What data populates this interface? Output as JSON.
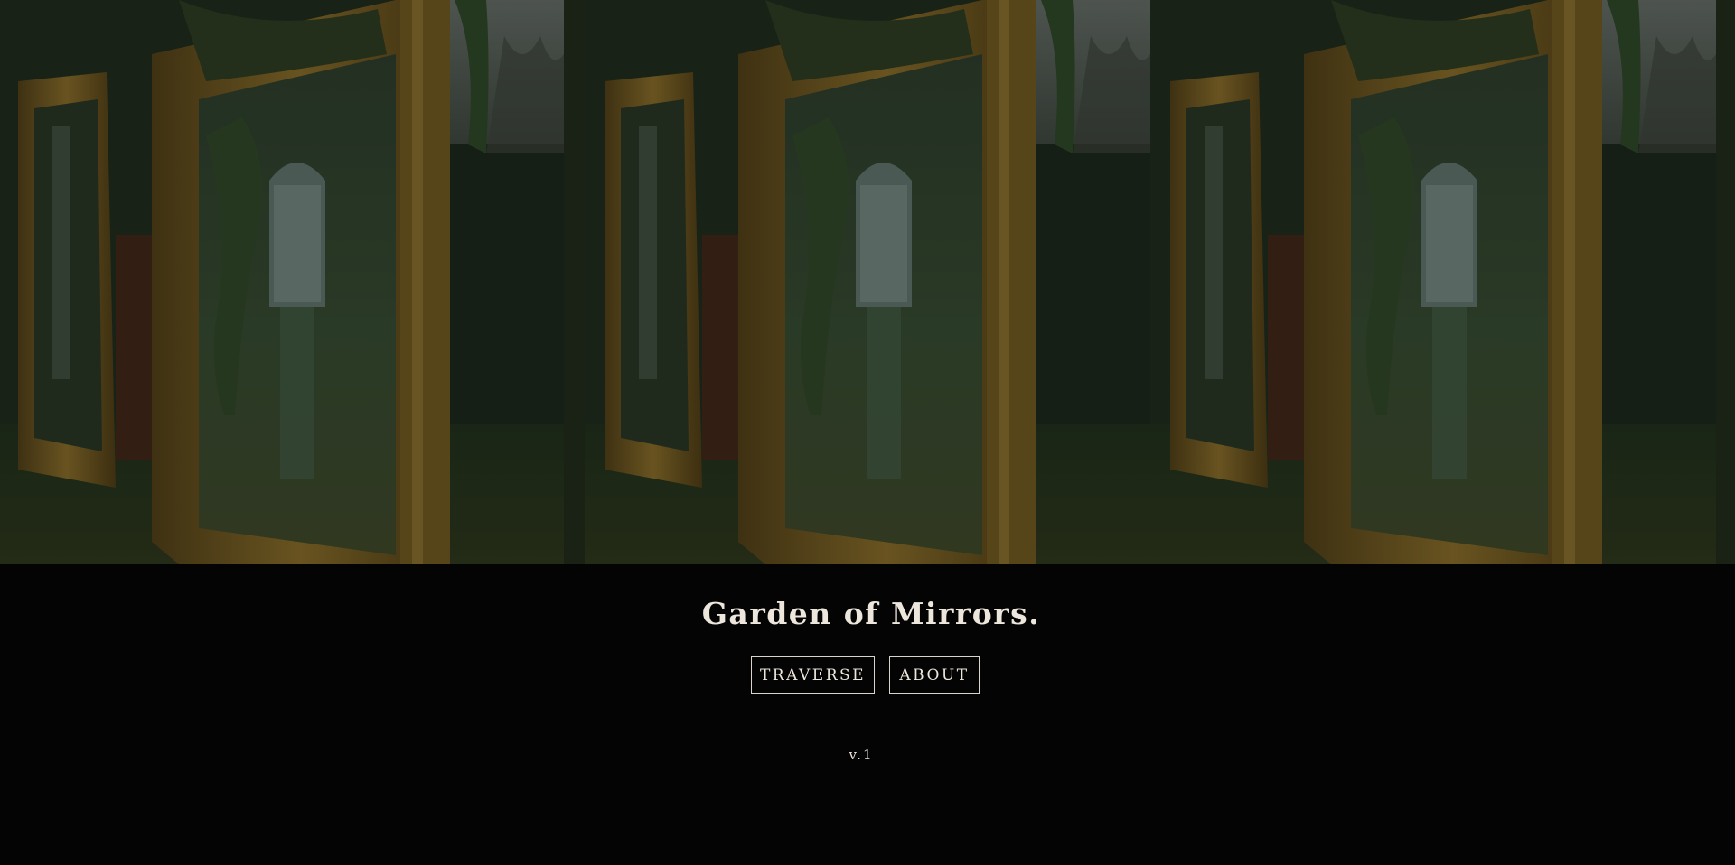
{
  "site": {
    "title": "Garden of Mirrors.",
    "version": "v.1"
  },
  "nav": {
    "items": [
      {
        "label": "TRAVERSE"
      },
      {
        "label": "ABOUT"
      }
    ]
  },
  "hero": {
    "image": "mirror-garden-photo",
    "repeat_count": 3,
    "colors": {
      "frame_gold": "#6b5520",
      "foliage": "#23341d",
      "mirror_glass": "#33462f",
      "page_background": "#040404",
      "text": "#ece6dc"
    }
  }
}
